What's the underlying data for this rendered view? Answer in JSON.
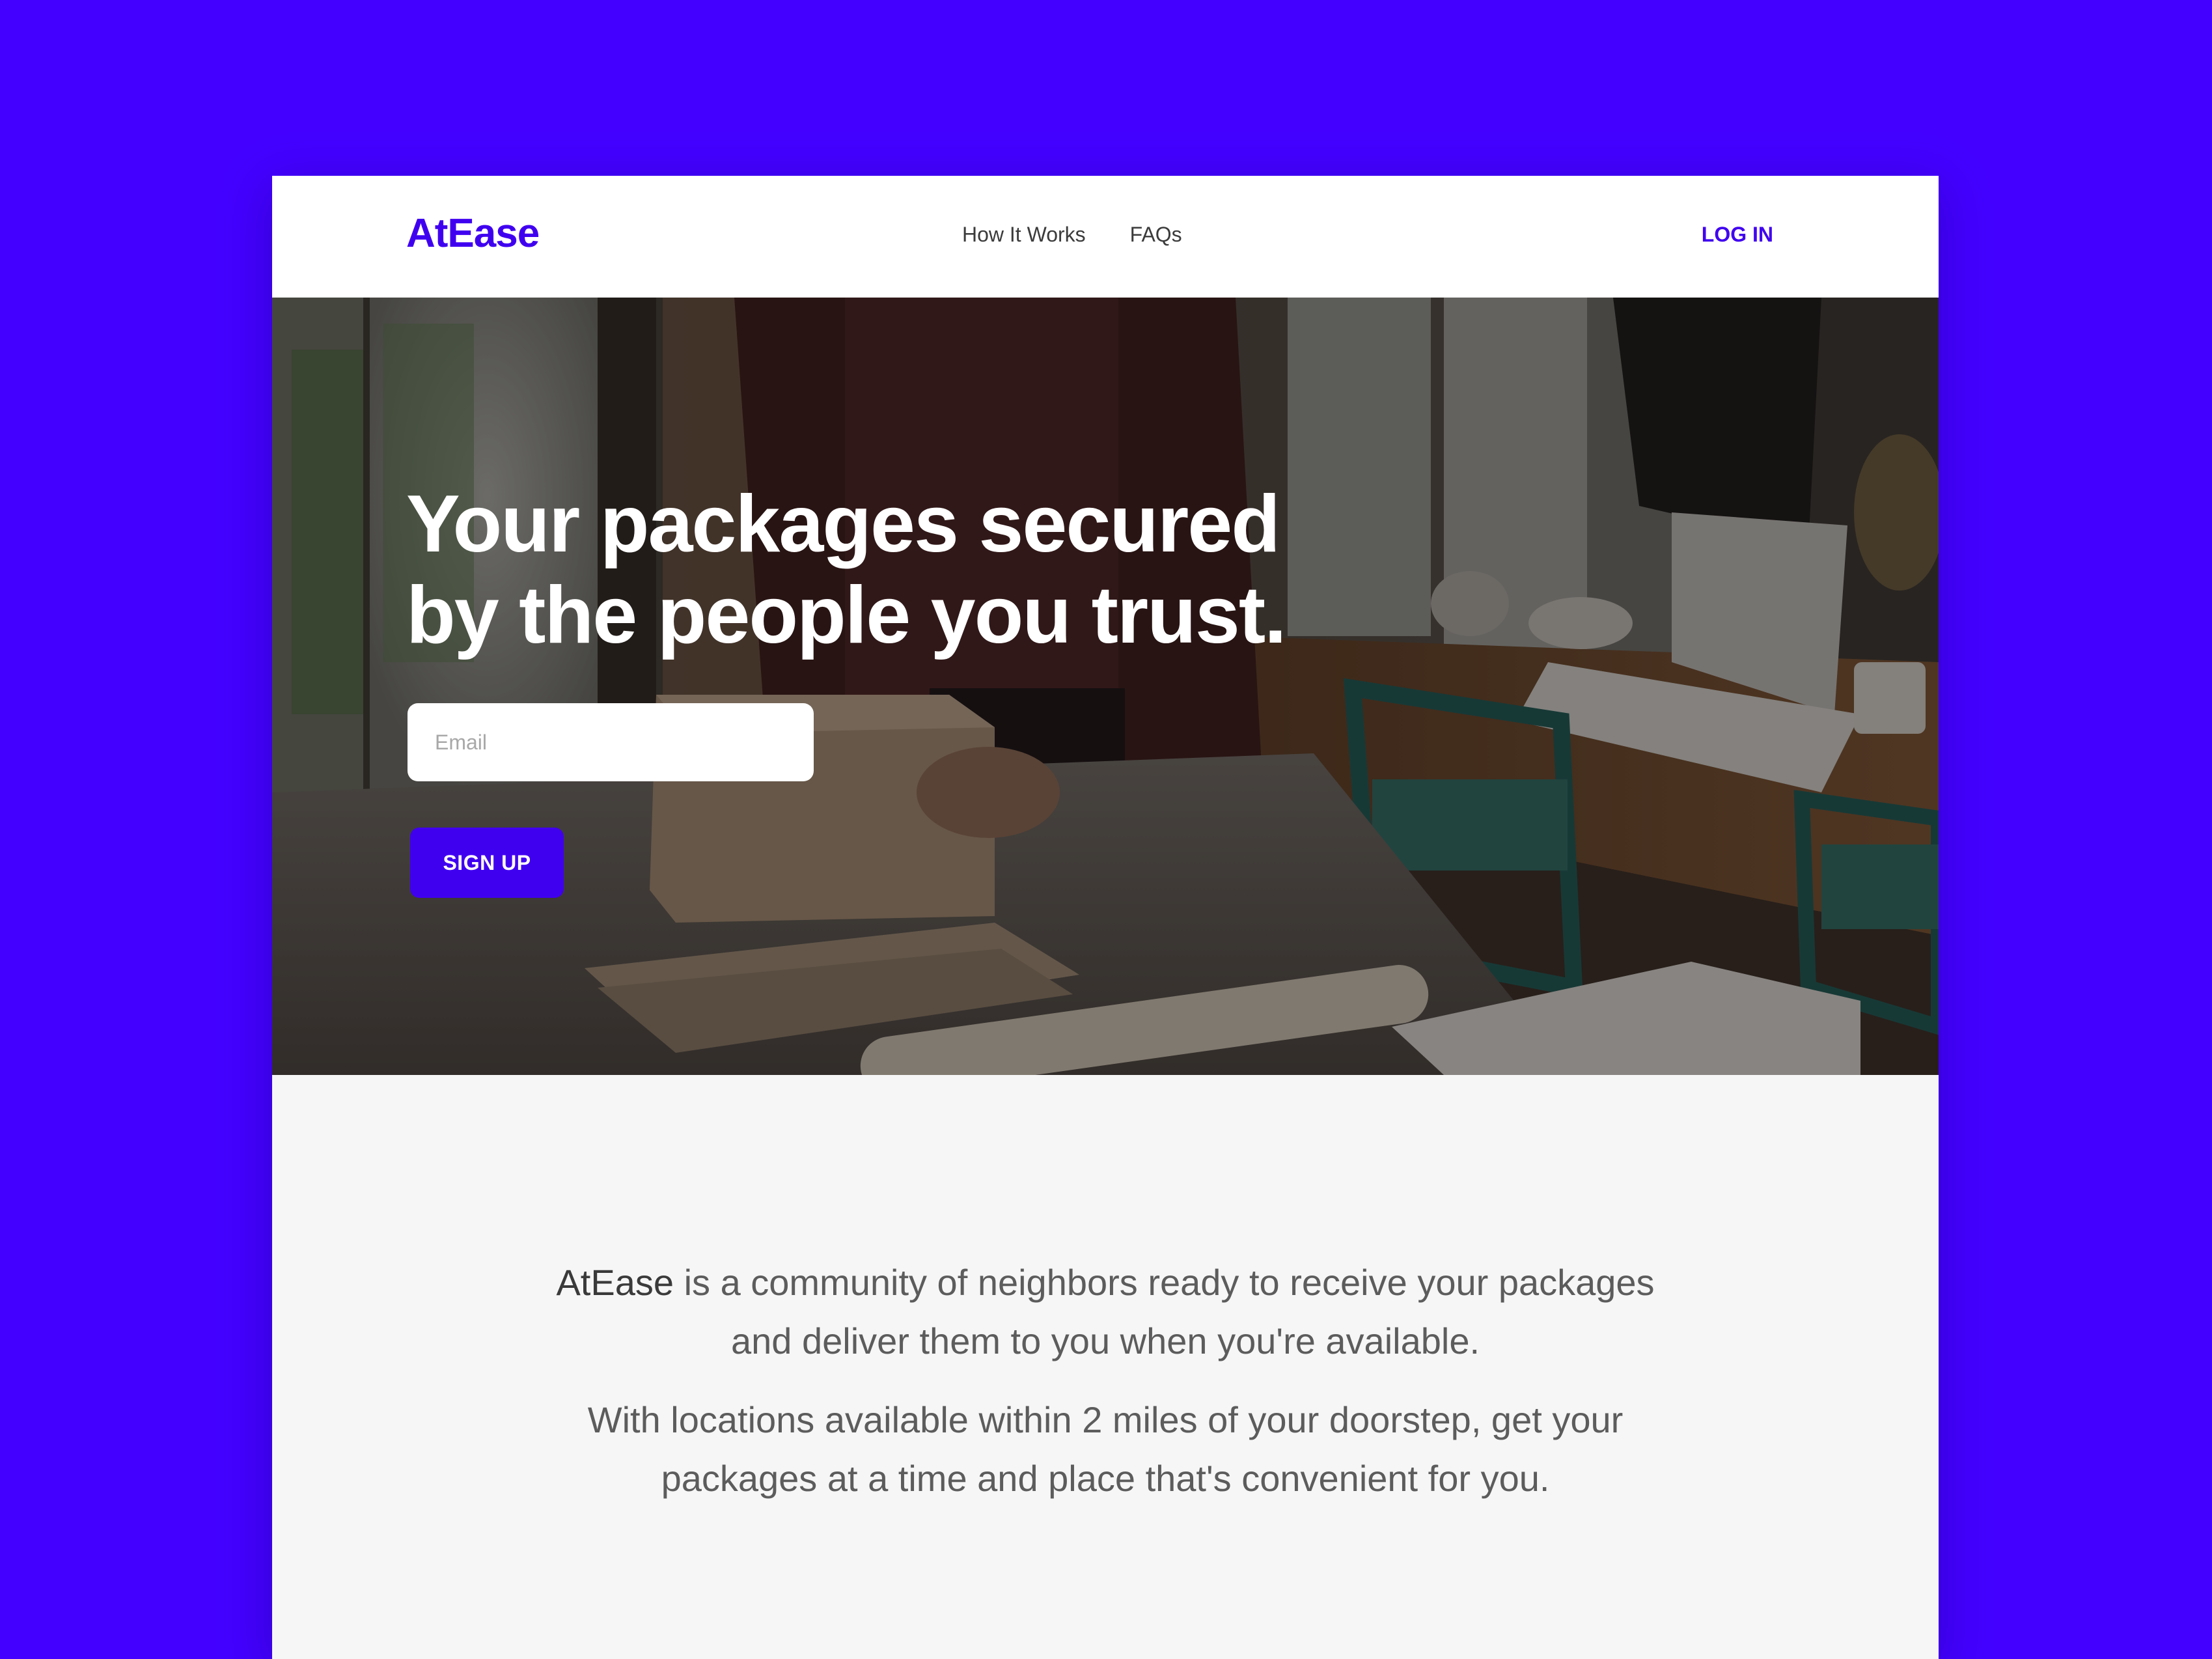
{
  "colors": {
    "background": "#4300ff",
    "accent": "#4000f0",
    "page": "#f6f6f6",
    "nav_bg": "#ffffff",
    "hero_text": "#ffffff",
    "body_text": "#5c5c5c"
  },
  "nav": {
    "brand": "AtEase",
    "links": [
      {
        "label": "How It Works"
      },
      {
        "label": "FAQs"
      }
    ],
    "login_label": "LOG IN"
  },
  "hero": {
    "title_line1": "Your packages secured",
    "title_line2": "by the people you trust.",
    "email_placeholder": "Email",
    "email_value": "",
    "signup_label": "SIGN UP"
  },
  "about": {
    "brand": "AtEase",
    "p1_line1_rest": "is a community of neighbors ready to receive your packages",
    "p1_line2": "and deliver them to you when you're available.",
    "p2_line1": "With locations available within 2 miles of your doorstep, get your",
    "p2_line2": "packages at a time and place that's convenient for you."
  }
}
